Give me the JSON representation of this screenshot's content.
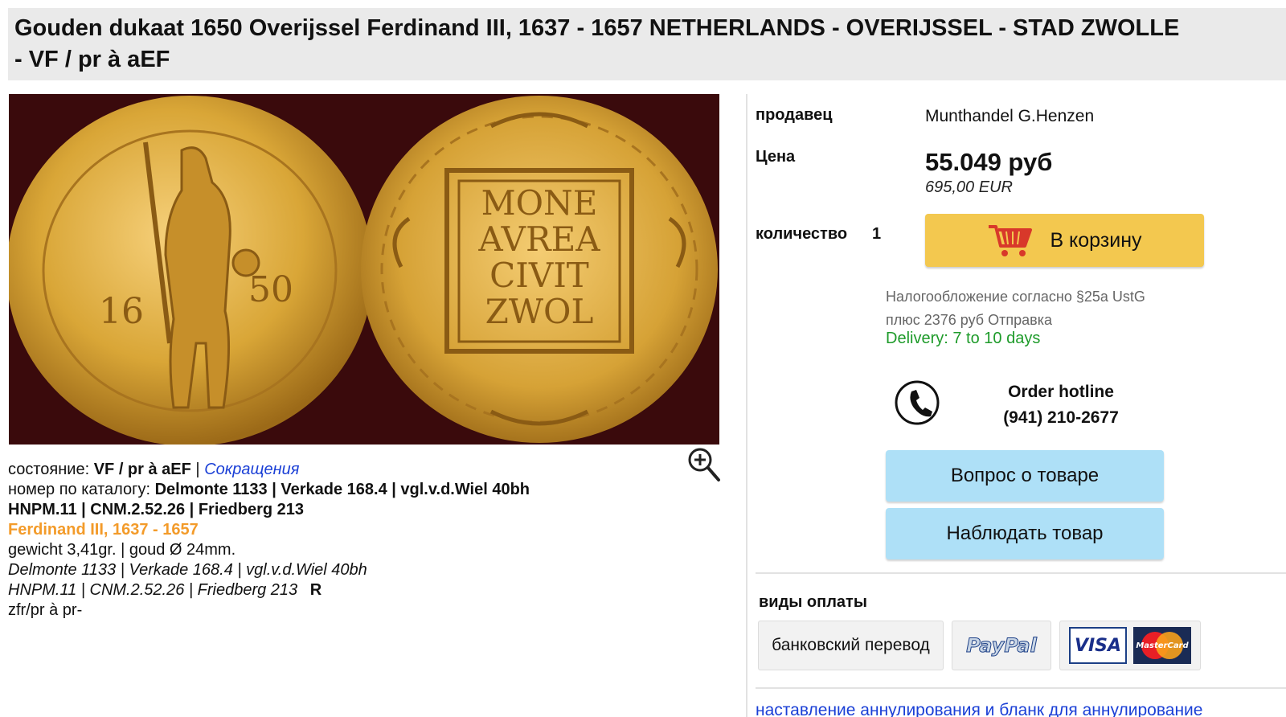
{
  "title": {
    "line1": "Gouden dukaat 1650 Overijssel Ferdinand III, 1637 - 1657 NETHERLANDS - OVERIJSSEL - STAD ZWOLLE",
    "line2": "- VF / pr à aEF"
  },
  "coin_reverse_text": [
    "MONE",
    "AVREA",
    "CIVIT",
    "ZWOL"
  ],
  "coin_obverse_date": [
    "16",
    "50"
  ],
  "details": {
    "condition_label": "состояние:",
    "condition_value": "VF / pr à aEF",
    "separator": "|",
    "abbrev_link": "Сокращения",
    "catalog_label": "номер по каталогу:",
    "catalog_value_line1": "Delmonte 1133 | Verkade 168.4 | vgl.v.d.Wiel 40bh",
    "catalog_value_line2": "HNPM.11 | CNM.2.52.26 | Friedberg 213",
    "ruler": "Ferdinand III, 1637 - 1657",
    "weight": "gewicht 3,41gr. | goud Ø 24mm.",
    "refs_line1": "Delmonte 1133 | Verkade 168.4 | vgl.v.d.Wiel 40bh",
    "refs_line2": "HNPM.11 | CNM.2.52.26 | Friedberg 213",
    "rarity": "R",
    "grade_note": "zfr/pr à pr-"
  },
  "sidebar": {
    "seller_label": "продавец",
    "seller_value": "Munthandel G.Henzen",
    "price_label": "Цена",
    "price_value": "55.049 руб",
    "price_eur": "695,00 EUR",
    "quantity_label": "количество",
    "quantity_value": "1",
    "cart_button": "В корзину",
    "tax_note": "Налогообложение согласно §25a UstG",
    "shipping_note": "плюс 2376 руб Отправка",
    "delivery": "Delivery: 7 to 10 days",
    "hotline_title": "Order hotline",
    "hotline_number": "(941) 210-2677",
    "question_button": "Вопрос о товаре",
    "watch_button": "Наблюдать товар",
    "payment_title": "виды оплаты",
    "payment_bank": "банковский перевод",
    "payment_paypal": "PayPal",
    "payment_visa": "VISA",
    "payment_mastercard": "MasterCard",
    "cancel_link": "наставление аннулирования и бланк для аннулирование"
  },
  "colors": {
    "title_bg": "#eaeaea",
    "cart_button": "#f3c84f",
    "blue_button": "#aee0f7",
    "link": "#1a3fd6",
    "ruler_orange": "#f39b2a",
    "delivery_green": "#1e9b2a",
    "coin_background": "#3a0a0c",
    "gold": "#d9a637"
  },
  "icons": [
    "cart-icon",
    "phone-icon",
    "zoom-in-icon"
  ]
}
